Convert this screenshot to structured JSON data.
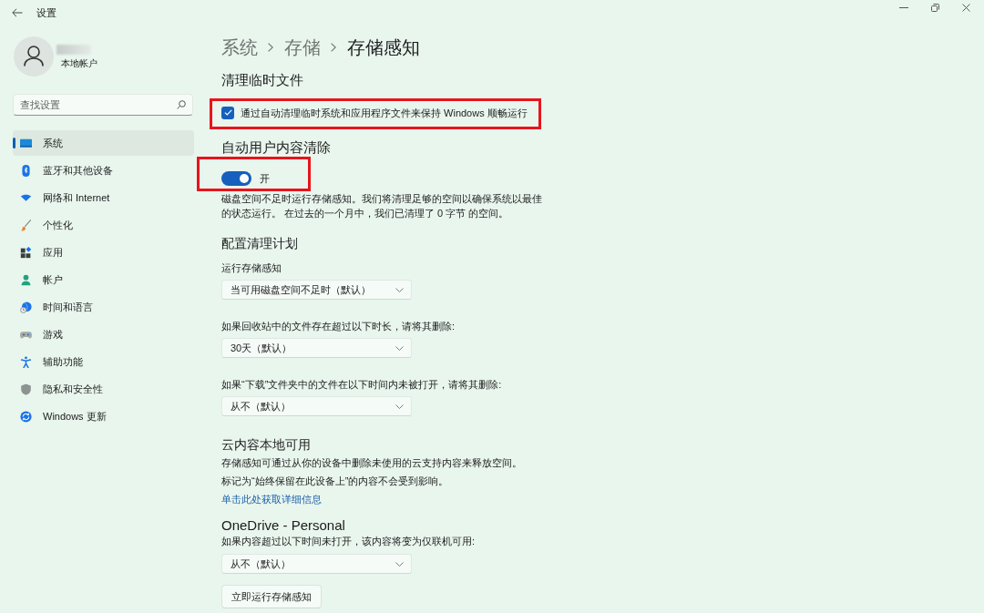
{
  "window": {
    "title": "设置"
  },
  "account": {
    "type": "本地帐户"
  },
  "search": {
    "placeholder": "查找设置"
  },
  "sidebar": {
    "items": [
      {
        "label": "系统",
        "selected": true
      },
      {
        "label": "蓝牙和其他设备",
        "selected": false
      },
      {
        "label": "网络和 Internet",
        "selected": false
      },
      {
        "label": "个性化",
        "selected": false
      },
      {
        "label": "应用",
        "selected": false
      },
      {
        "label": "帐户",
        "selected": false
      },
      {
        "label": "时间和语言",
        "selected": false
      },
      {
        "label": "游戏",
        "selected": false
      },
      {
        "label": "辅助功能",
        "selected": false
      },
      {
        "label": "隐私和安全性",
        "selected": false
      },
      {
        "label": "Windows 更新",
        "selected": false
      }
    ]
  },
  "breadcrumb": [
    "系统",
    "存储",
    "存储感知"
  ],
  "temp_files": {
    "heading": "清理临时文件",
    "checkbox": {
      "label": "通过自动清理临时系统和应用程序文件来保持 Windows 顺畅运行",
      "checked": true,
      "highlighted": true
    }
  },
  "auto_cleanup": {
    "heading": "自动用户内容清除",
    "toggle": {
      "label": "开",
      "on": true,
      "highlighted": true
    },
    "description": "磁盘空间不足时运行存储感知。我们将清理足够的空间以确保系统以最佳的状态运行。 在过去的一个月中，我们已清理了 0 字节 的空间。"
  },
  "schedule": {
    "heading": "配置清理计划",
    "settings": [
      {
        "label": "运行存储感知",
        "value": "当可用磁盘空间不足时（默认）"
      },
      {
        "label": "如果回收站中的文件存在超过以下时长，请将其删除:",
        "value": "30天（默认）"
      },
      {
        "label": "如果“下载”文件夹中的文件在以下时间内未被打开，请将其删除:",
        "value": "从不（默认）"
      }
    ]
  },
  "cloud": {
    "heading": "云内容本地可用",
    "lines": [
      "存储感知可通过从你的设备中删除未使用的云支持内容来释放空间。",
      "标记为“始终保留在此设备上”的内容不会受到影响。"
    ],
    "link": "单击此处获取详细信息"
  },
  "onedrive": {
    "heading": "OneDrive - Personal",
    "label": "如果内容超过以下时间未打开，该内容将变为仅联机可用:",
    "value": "从不（默认）"
  },
  "run_button": "立即运行存储感知"
}
